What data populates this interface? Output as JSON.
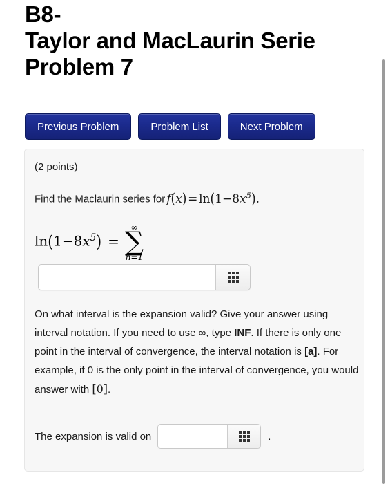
{
  "page_title": {
    "line1": "B8-",
    "line2": "Taylor and MacLaurin Serie",
    "line3": "Problem 7"
  },
  "nav": {
    "buttons": [
      {
        "label": "Previous Problem",
        "name": "previous-problem-button"
      },
      {
        "label": "Problem List",
        "name": "problem-list-button"
      },
      {
        "label": "Next Problem",
        "name": "next-problem-button"
      }
    ],
    "button_bg": "#1b2a8c",
    "button_text_color": "#ffffff"
  },
  "problem": {
    "points": "(2 points)",
    "prompt_text": "Find the Maclaurin series for",
    "prompt_math": {
      "f": "f",
      "open": "(",
      "var": "x",
      "close": ")",
      "equals": "=",
      "ln": "ln",
      "arg_open": "(",
      "one": "1",
      "minus": "−",
      "coef": "8",
      "x": "x",
      "exp": "5",
      "arg_close": ")",
      "period": "."
    },
    "display_equation": {
      "ln": "ln",
      "open": "(",
      "one": "1",
      "minus": "−",
      "coef": "8",
      "x": "x",
      "exp": "5",
      "close": ")",
      "equals": "=",
      "sigma": "∑",
      "upper_limit": "∞",
      "lower_limit": "n=1"
    },
    "answer_1": {
      "value": "",
      "placeholder": "",
      "keyboard_icon": "math-keypad-icon"
    },
    "instructions": {
      "part1": "On what interval is the expansion valid? Give your answer using interval notation. If you need to use ∞, type ",
      "bold1": "INF",
      "part2": ". If there is only one point in the interval of convergence, the interval notation is ",
      "bold2": "[a]",
      "part3": ". For example, if 0 is the only point in the interval of convergence, you would answer with ",
      "math_bracket": "[0]",
      "part4": "."
    },
    "final_line": {
      "label": "The expansion is valid on",
      "period": ".",
      "answer_2": {
        "value": "",
        "placeholder": "",
        "keyboard_icon": "math-keypad-icon"
      }
    },
    "panel_bg": "#f7f7f7"
  },
  "scrollbar": {
    "thumb_color": "#9b9b9b"
  }
}
